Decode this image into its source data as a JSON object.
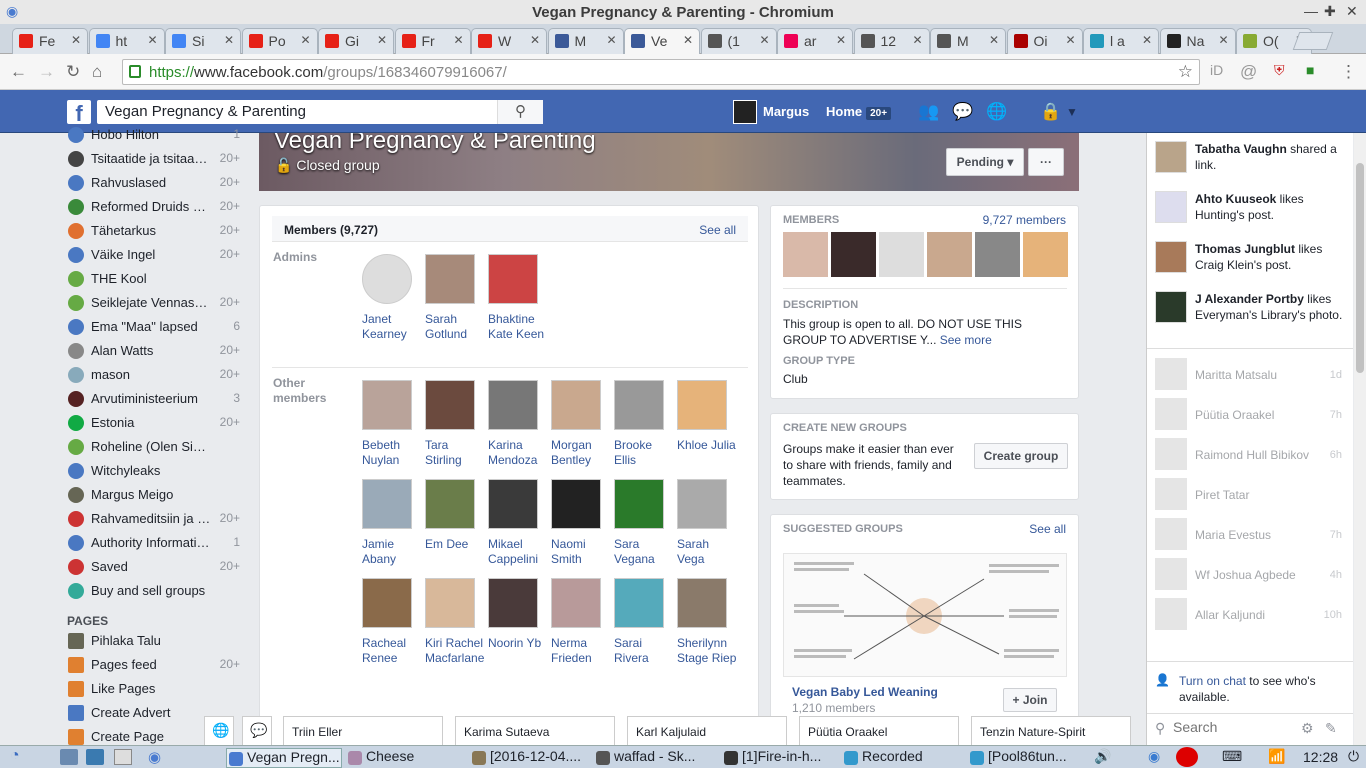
{
  "window": {
    "title": "Vegan Pregnancy & Parenting - Chromium"
  },
  "tabs": [
    {
      "label": "Fe",
      "color": "#e62117",
      "icon": "youtube-icon"
    },
    {
      "label": "ht",
      "color": "#4285f4",
      "icon": "google-icon"
    },
    {
      "label": "Si",
      "color": "#4285f4",
      "icon": "google-icon"
    },
    {
      "label": "Po",
      "color": "#e62117",
      "icon": "youtube-icon"
    },
    {
      "label": "Gi",
      "color": "#e62117",
      "icon": "youtube-icon"
    },
    {
      "label": "Fr",
      "color": "#e62117",
      "icon": "youtube-icon"
    },
    {
      "label": "W",
      "color": "#e62117",
      "icon": "youtube-icon"
    },
    {
      "label": "M",
      "color": "#3b5998",
      "icon": "facebook-icon"
    },
    {
      "label": "Ve",
      "color": "#3b5998",
      "icon": "facebook-icon",
      "active": true
    },
    {
      "label": "(1",
      "color": "#555",
      "icon": "page-icon"
    },
    {
      "label": "ar",
      "color": "#e05",
      "icon": "heart-icon"
    },
    {
      "label": "12",
      "color": "#555",
      "icon": "page-icon"
    },
    {
      "label": "M",
      "color": "#555",
      "icon": "page-icon"
    },
    {
      "label": "Oi",
      "color": "#a00",
      "icon": "page-icon"
    },
    {
      "label": "l a",
      "color": "#29b",
      "icon": "snowflake-icon"
    },
    {
      "label": "Na",
      "color": "#222",
      "icon": "wikipedia-icon"
    },
    {
      "label": "O(",
      "color": "#8a3",
      "icon": "cloud-icon"
    }
  ],
  "address": {
    "scheme": "https://",
    "host": "www.facebook.com",
    "path": "/groups/168346079916067/"
  },
  "fb": {
    "search_value": "Vegan Pregnancy & Parenting",
    "user": "Margus",
    "home": "Home",
    "home_count": "20+"
  },
  "leftnav": [
    {
      "label": "Hobo Hilton",
      "count": "1",
      "color": "#4a78c2"
    },
    {
      "label": "Tsitaatide ja tsitaadik...",
      "count": "20+",
      "color": "#444"
    },
    {
      "label": "Rahvuslased",
      "count": "20+",
      "color": "#4a78c2"
    },
    {
      "label": "Reformed Druids of ...",
      "count": "20+",
      "color": "#3a8a3a"
    },
    {
      "label": "Tähetarkus",
      "count": "20+",
      "color": "#e07030"
    },
    {
      "label": "Väike Ingel",
      "count": "20+",
      "color": "#4a78c2"
    },
    {
      "label": "THE Kool",
      "count": "",
      "color": "#6a4"
    },
    {
      "label": "Seiklejate Vennasko...",
      "count": "20+",
      "color": "#6a4"
    },
    {
      "label": "Ema \"Maa\" lapsed",
      "count": "6",
      "color": "#4a78c2"
    },
    {
      "label": "Alan Watts",
      "count": "20+",
      "color": "#888"
    },
    {
      "label": "mason",
      "count": "20+",
      "color": "#8ab"
    },
    {
      "label": "Arvutiministeerium",
      "count": "3",
      "color": "#522"
    },
    {
      "label": "Estonia",
      "count": "20+",
      "color": "#1a4"
    },
    {
      "label": "Roheline (Olen Sini...",
      "count": "",
      "color": "#6a4"
    },
    {
      "label": "Witchyleaks",
      "count": "",
      "color": "#4a78c2"
    },
    {
      "label": "Margus Meigo",
      "count": "",
      "color": "#665"
    },
    {
      "label": "Rahvameditsiin ja te...",
      "count": "20+",
      "color": "#c33"
    },
    {
      "label": "Authority Information...",
      "count": "1",
      "color": "#4a78c2"
    },
    {
      "label": "Saved",
      "count": "20+",
      "color": "#c33"
    },
    {
      "label": "Buy and sell groups",
      "count": "",
      "color": "#3a9"
    }
  ],
  "pages_header": "PAGES",
  "pages": [
    {
      "label": "Pihlaka Talu",
      "count": "",
      "color": "#665"
    },
    {
      "label": "Pages feed",
      "count": "20+",
      "color": "#e08030"
    },
    {
      "label": "Like Pages",
      "count": "",
      "color": "#e08030"
    },
    {
      "label": "Create Advert",
      "count": "",
      "color": "#4a78c2"
    },
    {
      "label": "Create Page",
      "count": "",
      "color": "#e08030"
    }
  ],
  "group": {
    "name": "Vegan Pregnancy & Parenting",
    "privacy": "Closed group",
    "pending": "Pending",
    "more": "···"
  },
  "members_card": {
    "title": "Members (9,727)",
    "see_all": "See all",
    "admins_label": "Admins",
    "other_label": "Other members",
    "admins": [
      {
        "name": "Janet Kearney",
        "color": "#ddd"
      },
      {
        "name": "Sarah Gotlund",
        "color": "#a78a7a"
      },
      {
        "name": "Bhaktine Kate Keen",
        "color": "#c44"
      }
    ],
    "others": [
      {
        "name": "Bebeth Nuylan",
        "color": "#b9a39a"
      },
      {
        "name": "Tara Stirling",
        "color": "#6b4a3e"
      },
      {
        "name": "Karina Mendoza",
        "color": "#777"
      },
      {
        "name": "Morgan Bentley",
        "color": "#c9a88e"
      },
      {
        "name": "Brooke Ellis",
        "color": "#999"
      },
      {
        "name": "Khloe Julia",
        "color": "#e6b37a"
      },
      {
        "name": "Jamie Abany",
        "color": "#9aaab8"
      },
      {
        "name": "Em Dee",
        "color": "#6a7d4a"
      },
      {
        "name": "Mikael Cappelini",
        "color": "#3a3a3a"
      },
      {
        "name": "Naomi Smith",
        "color": "#222"
      },
      {
        "name": "Sara Vegana",
        "color": "#2a7a2a"
      },
      {
        "name": "Sarah Vega",
        "color": "#aaa"
      },
      {
        "name": "Racheal Renee",
        "color": "#8a6a4a"
      },
      {
        "name": "Kiri Rachel Macfarlane",
        "color": "#d8b89a"
      },
      {
        "name": "Noorin Yb",
        "color": "#4a3a3a"
      },
      {
        "name": "Nerma Frieden",
        "color": "#b89a9a"
      },
      {
        "name": "Sarai Rivera",
        "color": "#5ab"
      },
      {
        "name": "Sherilynn Stage Riep",
        "color": "#8a7a6a"
      }
    ]
  },
  "about": {
    "members_label": "MEMBERS",
    "members_count": "9,727 members",
    "thumb_colors": [
      "#d9b9a9",
      "#3a2a2a",
      "#ddd",
      "#c9a88e",
      "#888",
      "#e6b37a"
    ],
    "desc_label": "DESCRIPTION",
    "desc": "This group is open to all. DO NOT USE THIS GROUP TO ADVERTISE Y...",
    "see_more": "See more",
    "type_label": "GROUP TYPE",
    "type": "Club"
  },
  "create": {
    "label": "CREATE NEW GROUPS",
    "text": "Groups make it easier than ever to share with friends, family and teammates.",
    "button": "Create group"
  },
  "suggested": {
    "label": "SUGGESTED GROUPS",
    "see_all": "See all",
    "group_name": "Vegan Baby Led Weaning",
    "group_members": "1,210 members",
    "join": "+ Join"
  },
  "ticker": [
    {
      "name": "Tabatha Vaughn",
      "action": " shared a link.",
      "color": "#b9a48a"
    },
    {
      "name": "Ahto Kuuseok",
      "action": " likes Hunting's post.",
      "color": "#dde"
    },
    {
      "name": "Thomas Jungblut",
      "action": " likes Craig Klein's post.",
      "color": "#a87a5a"
    },
    {
      "name": "J Alexander Portby",
      "action": " likes Everyman's Library's photo.",
      "color": "#2a3a2a"
    }
  ],
  "contacts": [
    {
      "name": "Maritta Matsalu",
      "time": "1d"
    },
    {
      "name": "Püütia Oraakel",
      "time": "7h"
    },
    {
      "name": "Raimond Hull Bibikov",
      "time": "6h"
    },
    {
      "name": "Piret Tatar",
      "time": ""
    },
    {
      "name": "Maria Evestus",
      "time": "7h"
    },
    {
      "name": "Wf Joshua Agbede",
      "time": "4h"
    },
    {
      "name": "Allar Kaljundi",
      "time": "10h"
    }
  ],
  "chat": {
    "turn_on": "Turn on chat",
    "turn_on_rest": " to see who's available.",
    "search_placeholder": "Search"
  },
  "chat_tabs": [
    "Triin Eller",
    "Karima Sutaeva",
    "Karl Kaljulaid",
    "Püütia Oraakel",
    "Tenzin Nature-Spirit"
  ],
  "taskbar": {
    "items": [
      "Vegan Pregn...",
      "Cheese",
      "[2016-12-04....",
      "waffad - Sk...",
      "[1]Fire-in-h...",
      "Recorded",
      "[Pool86tun..."
    ],
    "clock": "12:28"
  }
}
